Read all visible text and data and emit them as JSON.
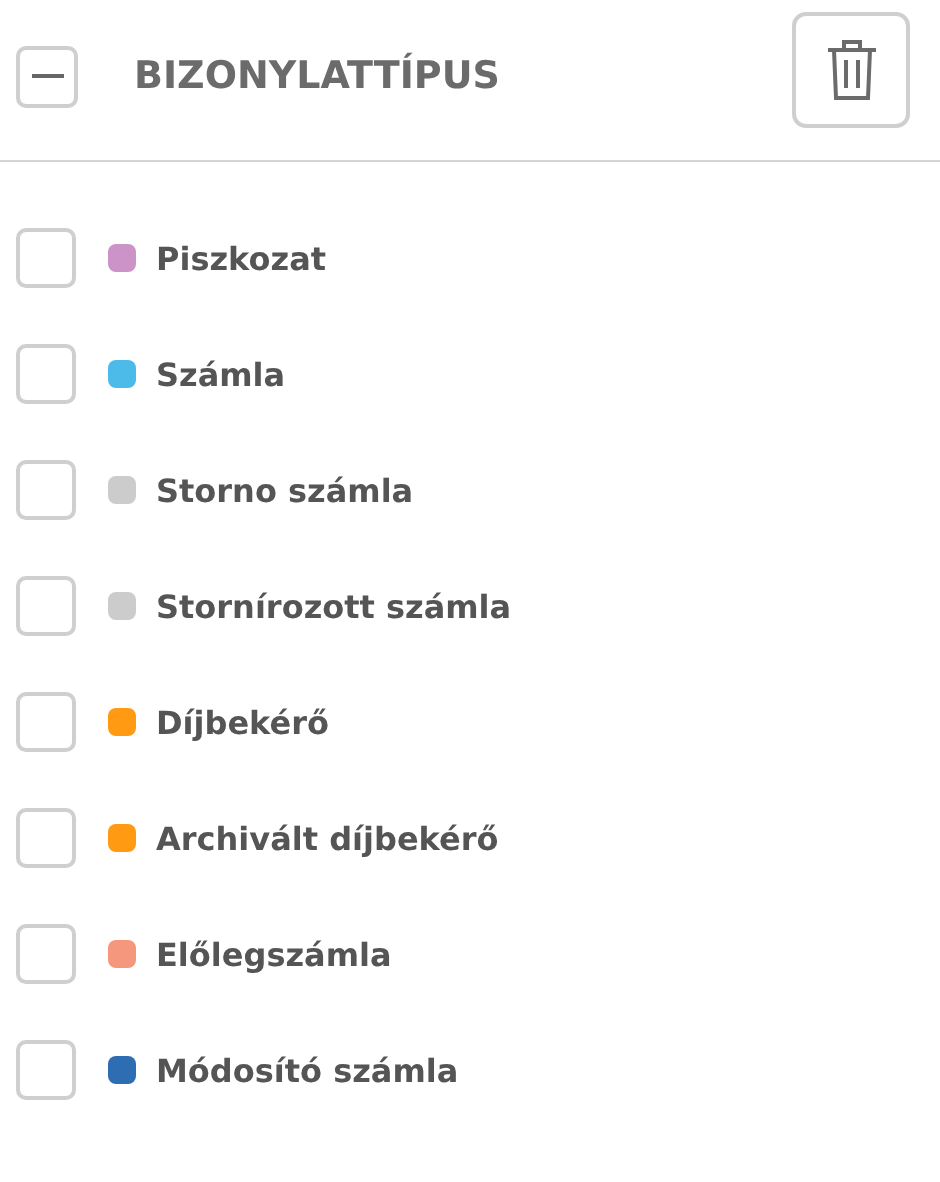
{
  "filter": {
    "title": "BIZONYLATTÍPUS",
    "expanded": true,
    "items": [
      {
        "label": "Piszkozat",
        "checked": false,
        "color": "#cc93c9"
      },
      {
        "label": "Számla",
        "checked": false,
        "color": "#4dbbe9"
      },
      {
        "label": "Storno számla",
        "checked": false,
        "color": "#cccccc"
      },
      {
        "label": "Stornírozott számla",
        "checked": false,
        "color": "#cccccc"
      },
      {
        "label": "Díjbekérő",
        "checked": false,
        "color": "#ff9a12"
      },
      {
        "label": "Archivált díjbekérő",
        "checked": false,
        "color": "#ff9a12"
      },
      {
        "label": "Előlegszámla",
        "checked": false,
        "color": "#f5977c"
      },
      {
        "label": "Módosító számla",
        "checked": false,
        "color": "#2f6db3"
      }
    ]
  }
}
